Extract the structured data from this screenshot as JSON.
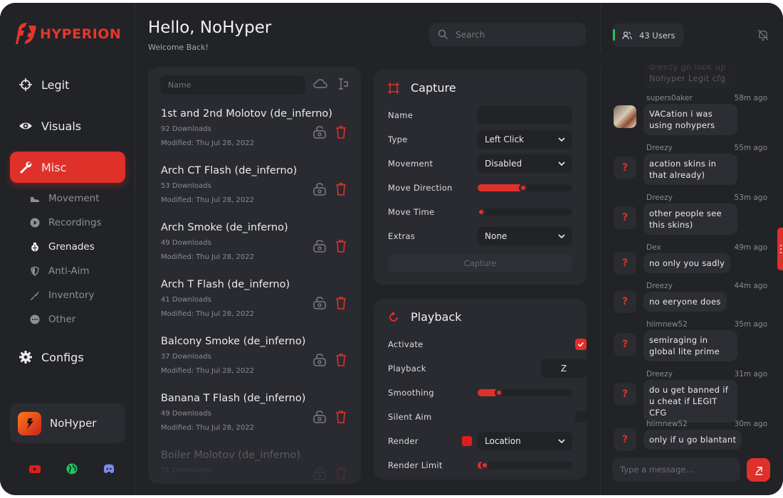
{
  "app": {
    "logo_text": "HYPERION",
    "accent": "#e0302a"
  },
  "nav": {
    "items": [
      {
        "label": "Legit",
        "icon": "crosshair-icon"
      },
      {
        "label": "Visuals",
        "icon": "eye-icon"
      },
      {
        "label": "Misc",
        "icon": "wrench-icon",
        "active": true
      },
      {
        "label": "Configs",
        "icon": "gear-icon"
      }
    ],
    "sub_items": [
      {
        "label": "Movement",
        "icon": "shoe-icon"
      },
      {
        "label": "Recordings",
        "icon": "play-circle-icon"
      },
      {
        "label": "Grenades",
        "icon": "grenade-icon",
        "active": true
      },
      {
        "label": "Anti-Aim",
        "icon": "shield-icon"
      },
      {
        "label": "Inventory",
        "icon": "knife-icon"
      },
      {
        "label": "Other",
        "icon": "more-icon"
      }
    ]
  },
  "user": {
    "name": "NoHyper"
  },
  "socials": [
    "youtube-icon",
    "globe-icon",
    "discord-icon"
  ],
  "header": {
    "greeting": "Hello, NoHyper",
    "subtitle": "Welcome Back!",
    "search_placeholder": "Search"
  },
  "list": {
    "name_placeholder": "Name",
    "items": [
      {
        "title": "1st and 2nd Molotov (de_inferno)",
        "downloads": "92 Downloads",
        "modified": "Modified: Thu Jul 28, 2022"
      },
      {
        "title": "Arch CT Flash (de_inferno)",
        "downloads": "53 Downloads",
        "modified": "Modified: Thu Jul 28, 2022"
      },
      {
        "title": "Arch Smoke (de_inferno)",
        "downloads": "49 Downloads",
        "modified": "Modified: Thu Jul 28, 2022"
      },
      {
        "title": "Arch T Flash (de_inferno)",
        "downloads": "41 Downloads",
        "modified": "Modified: Thu Jul 28, 2022"
      },
      {
        "title": "Balcony Smoke (de_inferno)",
        "downloads": "37 Downloads",
        "modified": "Modified: Thu Jul 28, 2022"
      },
      {
        "title": "Banana T Flash (de_inferno)",
        "downloads": "49 Downloads",
        "modified": "Modified: Thu Jul 28, 2022"
      },
      {
        "title": "Boiler Molotov (de_inferno)",
        "downloads": "31 Downloads",
        "modified": ""
      }
    ]
  },
  "capture": {
    "title": "Capture",
    "name_label": "Name",
    "name_value": "",
    "type_label": "Type",
    "type_value": "Left Click",
    "movement_label": "Movement",
    "movement_value": "Disabled",
    "move_direction_label": "Move Direction",
    "move_direction_level": 0.5,
    "move_time_label": "Move Time",
    "move_time_level": 0.05,
    "extras_label": "Extras",
    "extras_value": "None",
    "button_label": "Capture"
  },
  "playback": {
    "title": "Playback",
    "activate_label": "Activate",
    "activate_checked": true,
    "playback_label": "Playback",
    "playback_key": "Z",
    "smoothing_label": "Smoothing",
    "smoothing_level": 0.25,
    "silent_aim_label": "Silent Aim",
    "silent_aim_checked": false,
    "render_label": "Render",
    "render_color": "#e01e1e",
    "render_value": "Location",
    "render_limit_label": "Render Limit",
    "render_limit_level": 0.1
  },
  "chat": {
    "users": "43 Users",
    "input_placeholder": "Type a message...",
    "messages": [
      {
        "user": "",
        "time": "",
        "text": "dreezy go look up Nohyper Legit cfg",
        "avatar": "?"
      },
      {
        "user": "supers0aker",
        "time": "58m ago",
        "text": "VACation i was using nohypers",
        "avatar": "photo"
      },
      {
        "user": "Dreezy",
        "time": "55m ago",
        "text": "acation skins in that already)",
        "avatar": "?"
      },
      {
        "user": "Dreezy",
        "time": "53m ago",
        "text": "other people see this skins)",
        "avatar": "?"
      },
      {
        "user": "Dex",
        "time": "49m ago",
        "text": "no only you sadly",
        "avatar": "?"
      },
      {
        "user": "Dreezy",
        "time": "44m ago",
        "text": "no eeryone does",
        "avatar": "?"
      },
      {
        "user": "hiimnew52",
        "time": "35m ago",
        "text": "semiraging in global lite prime",
        "avatar": "?"
      },
      {
        "user": "Dreezy",
        "time": "31m ago",
        "text": "do u get banned if u cheat if LEGIT CFG",
        "avatar": "?"
      },
      {
        "user": "hiimnew52",
        "time": "30m ago",
        "text": "only if u go blantant",
        "avatar": "?"
      }
    ]
  }
}
